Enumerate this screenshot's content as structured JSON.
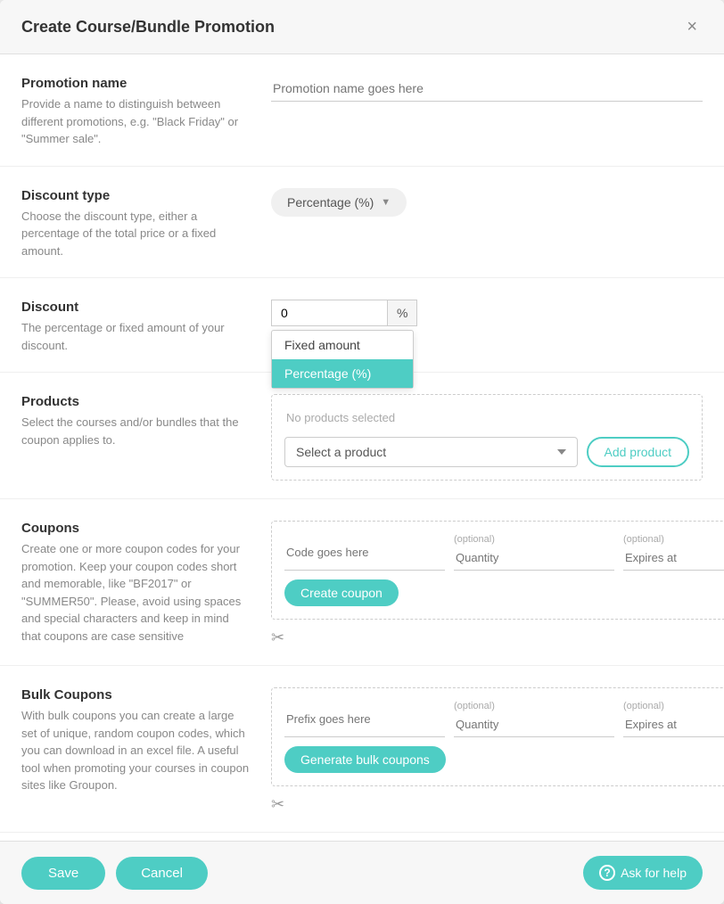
{
  "modal": {
    "title": "Create Course/Bundle Promotion",
    "close_label": "×"
  },
  "promotion_name": {
    "label": "Promotion name",
    "desc": "Provide a name to distinguish between different promotions, e.g. \"Black Friday\" or \"Summer sale\".",
    "placeholder": "Promotion name goes here"
  },
  "discount_type": {
    "label": "Discount type",
    "desc": "Choose the discount type, either a percentage of the total price or a fixed amount.",
    "selected": "Percentage (%)",
    "options": [
      "Fixed amount",
      "Percentage (%)"
    ]
  },
  "discount": {
    "label": "Discount",
    "desc": "The percentage or fixed amount of your discount.",
    "value": "0",
    "unit": "%",
    "dropdown": {
      "item1": "Fixed amount",
      "item2": "Percentage (%)"
    }
  },
  "products": {
    "label": "Products",
    "desc": "Select the courses and/or bundles that the coupon applies to.",
    "no_products": "No products selected",
    "select_placeholder": "Select a product",
    "add_btn": "Add product"
  },
  "coupons": {
    "label": "Coupons",
    "desc": "Create one or more coupon codes for your promotion. Keep your coupon codes short and memorable, like \"BF2017\" or \"SUMMER50\". Please, avoid using spaces and special characters and keep in mind that coupons are case sensitive",
    "code_placeholder": "Code goes here",
    "quantity_placeholder": "Quantity",
    "quantity_label": "(optional)",
    "expires_placeholder": "Expires at",
    "expires_label": "(optional)",
    "create_btn": "Create coupon"
  },
  "bulk_coupons": {
    "label": "Bulk Coupons",
    "desc": "With bulk coupons you can create a large set of unique, random coupon codes, which you can download in an excel file. A useful tool when promoting your courses in coupon sites like Groupon.",
    "prefix_placeholder": "Prefix goes here",
    "quantity_placeholder": "Quantity",
    "quantity_label": "(optional)",
    "expires_placeholder": "Expires at",
    "expires_label": "(optional)",
    "generate_btn": "Generate bulk coupons"
  },
  "footer": {
    "save_btn": "Save",
    "cancel_btn": "Cancel",
    "help_btn": "Ask for help"
  }
}
